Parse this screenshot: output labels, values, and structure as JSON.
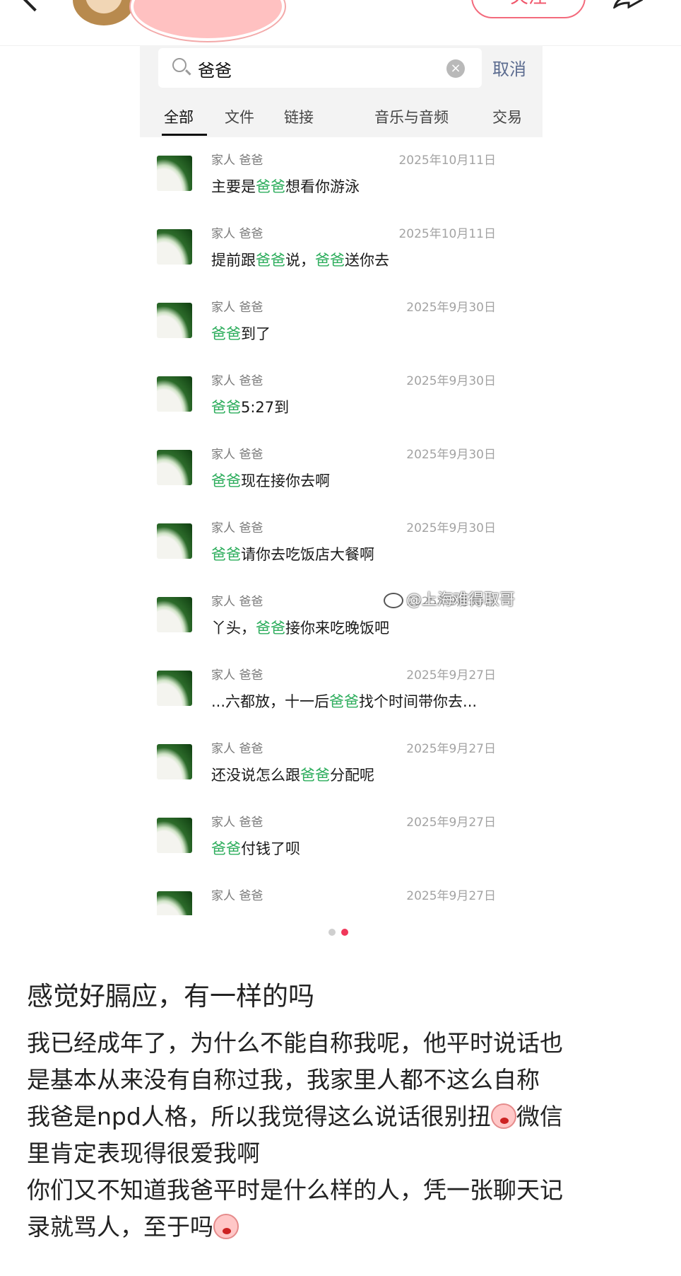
{
  "header": {
    "follow_label": "关注"
  },
  "search": {
    "value": "爸爸",
    "cancel_label": "取消",
    "tabs": [
      "全部",
      "文件",
      "链接",
      "音乐与音频",
      "交易"
    ]
  },
  "results": [
    {
      "meta": "家人 爸爸",
      "date": "2025年10月11日",
      "parts": [
        [
          "主要是",
          false
        ],
        [
          "爸爸",
          true
        ],
        [
          "想看你游泳",
          false
        ]
      ]
    },
    {
      "meta": "家人 爸爸",
      "date": "2025年10月11日",
      "parts": [
        [
          "提前跟",
          false
        ],
        [
          "爸爸",
          true
        ],
        [
          "说，",
          false
        ],
        [
          "爸爸",
          true
        ],
        [
          "送你去",
          false
        ]
      ]
    },
    {
      "meta": "家人 爸爸",
      "date": "2025年9月30日",
      "parts": [
        [
          "爸爸",
          true
        ],
        [
          "到了",
          false
        ]
      ]
    },
    {
      "meta": "家人 爸爸",
      "date": "2025年9月30日",
      "parts": [
        [
          "爸爸",
          true
        ],
        [
          "5:27到",
          false
        ]
      ]
    },
    {
      "meta": "家人 爸爸",
      "date": "2025年9月30日",
      "parts": [
        [
          "爸爸",
          true
        ],
        [
          "现在接你去啊",
          false
        ]
      ]
    },
    {
      "meta": "家人 爸爸",
      "date": "2025年9月30日",
      "parts": [
        [
          "爸爸",
          true
        ],
        [
          "请你去吃饭店大餐啊",
          false
        ]
      ]
    },
    {
      "meta": "家人 爸爸",
      "date": "2025年9月30日",
      "parts": [
        [
          "丫头，",
          false
        ],
        [
          "爸爸",
          true
        ],
        [
          "接你来吃晚饭吧",
          false
        ]
      ]
    },
    {
      "meta": "家人 爸爸",
      "date": "2025年9月27日",
      "parts": [
        [
          "...六都放，十一后",
          false
        ],
        [
          "爸爸",
          true
        ],
        [
          "找个时间带你去...",
          false
        ]
      ]
    },
    {
      "meta": "家人 爸爸",
      "date": "2025年9月27日",
      "parts": [
        [
          "还没说怎么跟",
          false
        ],
        [
          "爸爸",
          true
        ],
        [
          "分配呢",
          false
        ]
      ]
    },
    {
      "meta": "家人 爸爸",
      "date": "2025年9月27日",
      "parts": [
        [
          "爸爸",
          true
        ],
        [
          "付钱了呗",
          false
        ]
      ]
    },
    {
      "meta": "家人 爸爸",
      "date": "2025年9月27日",
      "parts": []
    }
  ],
  "watermark": "@上海难得取哥",
  "post": {
    "title": "感觉好膈应，有一样的吗",
    "lines": [
      "我已经成年了，为什么不能自称我呢，他平时说话也",
      "是基本从来没有自称过我，我家里人都不这么自称",
      "我爸是npd人格，所以我觉得这么说话很别扭",
      "微信",
      "里肯定表现得很爱我啊",
      "你们又不知道我爸平时是什么样的人，凭一张聊天记",
      "录就骂人，至于吗"
    ]
  }
}
